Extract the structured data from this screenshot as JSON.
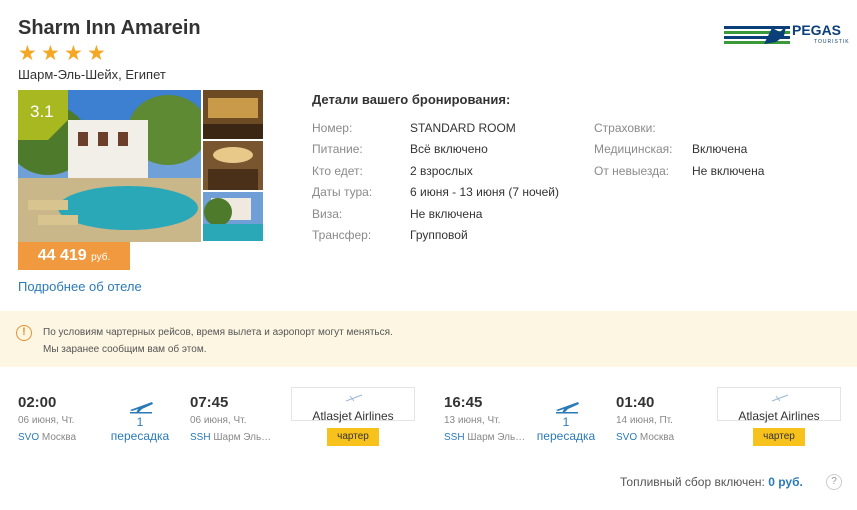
{
  "hotel": {
    "name": "Sharm Inn Amarein",
    "stars": 4,
    "location": "Шарм-Эль-Шейх, Египет",
    "rating": "3.1",
    "price": "44 419",
    "currency": "руб.",
    "more_link": "Подробнее об отеле"
  },
  "operator": {
    "name": "PEGAS",
    "sub": "TOURISTIK"
  },
  "details": {
    "title": "Детали вашего бронирования:",
    "left": [
      {
        "label": "Номер:",
        "value": "STANDARD ROOM"
      },
      {
        "label": "Питание:",
        "value": "Всё включено"
      },
      {
        "label": "Кто едет:",
        "value": "2 взрослых"
      },
      {
        "label": "Даты тура:",
        "value": "6 июня - 13 июня (7 ночей)"
      },
      {
        "label": "Виза:",
        "value": "Не включена"
      },
      {
        "label": "Трансфер:",
        "value": "Групповой"
      }
    ],
    "right": [
      {
        "label": "Страховки:",
        "value": ""
      },
      {
        "label": "Медицинская:",
        "value": "Включена"
      },
      {
        "label": "От невыезда:",
        "value": "Не включена"
      }
    ]
  },
  "notice": {
    "line1": "По условиям чартерных рейсов, время вылета и аэропорт могут меняться.",
    "line2": "Мы заранее сообщим вам об этом."
  },
  "flights": [
    {
      "dep_time": "02:00",
      "dep_date": "06 июня, Чт.",
      "dep_code": "SVO",
      "dep_city": "Москва",
      "stops_count": "1",
      "stops_label": "пересадка",
      "arr_time": "07:45",
      "arr_date": "06 июня, Чт.",
      "arr_code": "SSH",
      "arr_city": "Шарм Эль…",
      "airline": "Atlasjet Airlines",
      "badge": "чартер"
    },
    {
      "dep_time": "16:45",
      "dep_date": "13 июня, Чт.",
      "dep_code": "SSH",
      "dep_city": "Шарм Эль…",
      "stops_count": "1",
      "stops_label": "пересадка",
      "arr_time": "01:40",
      "arr_date": "14 июня, Пт.",
      "arr_code": "SVO",
      "arr_city": "Москва",
      "airline": "Atlasjet Airlines",
      "badge": "чартер"
    }
  ],
  "fuel": {
    "label": "Топливный сбор включен:",
    "value": "0 руб.",
    "help": "?"
  },
  "colors": {
    "accent": "#2b7ab8",
    "price": "#f1993f",
    "rating": "#a8b821",
    "charter": "#f7c21c",
    "star": "#f5a623"
  }
}
